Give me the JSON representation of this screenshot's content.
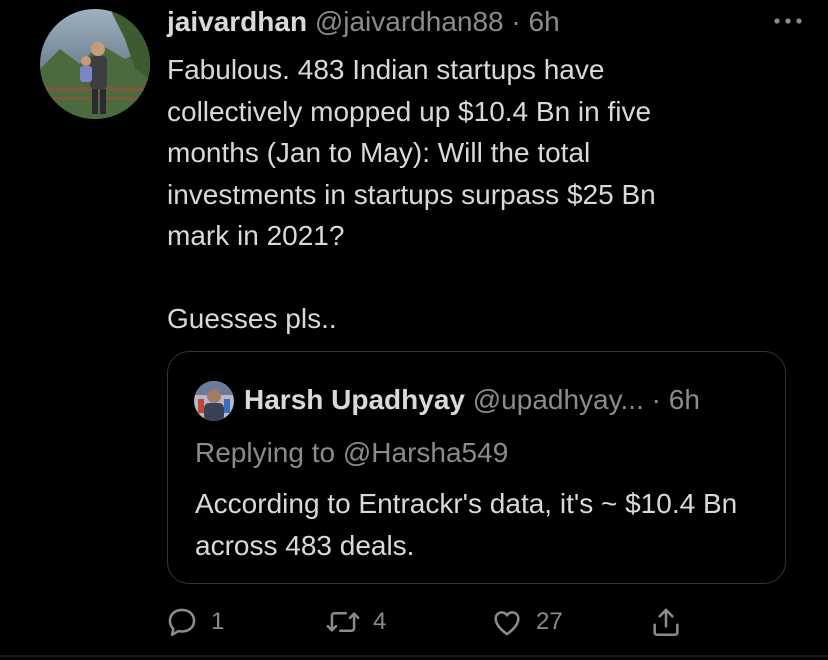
{
  "tweet": {
    "display_name": "jaivardhan",
    "handle": "@jaivardhan88",
    "separator": " · ",
    "time": "6h",
    "text": "Fabulous. 483 Indian startups have\ncollectively mopped up $10.4 Bn in five\nmonths (Jan to May): Will the total\ninvestments in startups surpass $25 Bn\nmark in 2021?\n\nGuesses pls.."
  },
  "quoted_tweet": {
    "display_name": "Harsh Upadhyay",
    "handle": "@upadhyay...",
    "separator": " · ",
    "time": "6h",
    "replying_to": "Replying to @Harsha549",
    "text": "According to Entrackr's data, it's ~ $10.4 Bn across 483 deals."
  },
  "actions": {
    "reply_count": "1",
    "retweet_count": "4",
    "like_count": "27"
  },
  "icons": {
    "reply": "reply-icon",
    "retweet": "retweet-icon",
    "like": "heart-icon",
    "share": "share-icon",
    "more": "more-icon"
  },
  "colors": {
    "background": "#000000",
    "text": "#d9d9d9",
    "secondary": "#8b8b8b",
    "border": "#333333"
  }
}
